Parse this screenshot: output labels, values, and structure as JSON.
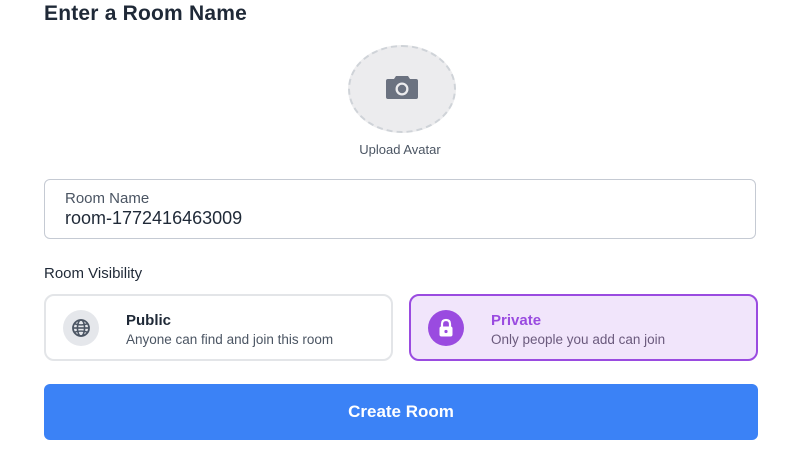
{
  "header": {
    "title": "Enter a Room Name"
  },
  "avatar": {
    "icon": "camera-icon",
    "label": "Upload Avatar"
  },
  "room_name": {
    "label": "Room Name",
    "value": "room-1772416463009"
  },
  "visibility": {
    "label": "Room Visibility",
    "selected": "private",
    "options": [
      {
        "id": "public",
        "icon": "globe-icon",
        "title": "Public",
        "description": "Anyone can find and join this room"
      },
      {
        "id": "private",
        "icon": "lock-icon",
        "title": "Private",
        "description": "Only people you add can join"
      }
    ]
  },
  "actions": {
    "create_label": "Create Room"
  },
  "colors": {
    "primary": "#3b82f6",
    "accent_purple": "#9a4be0",
    "selected_bg": "#f1e5fb"
  }
}
